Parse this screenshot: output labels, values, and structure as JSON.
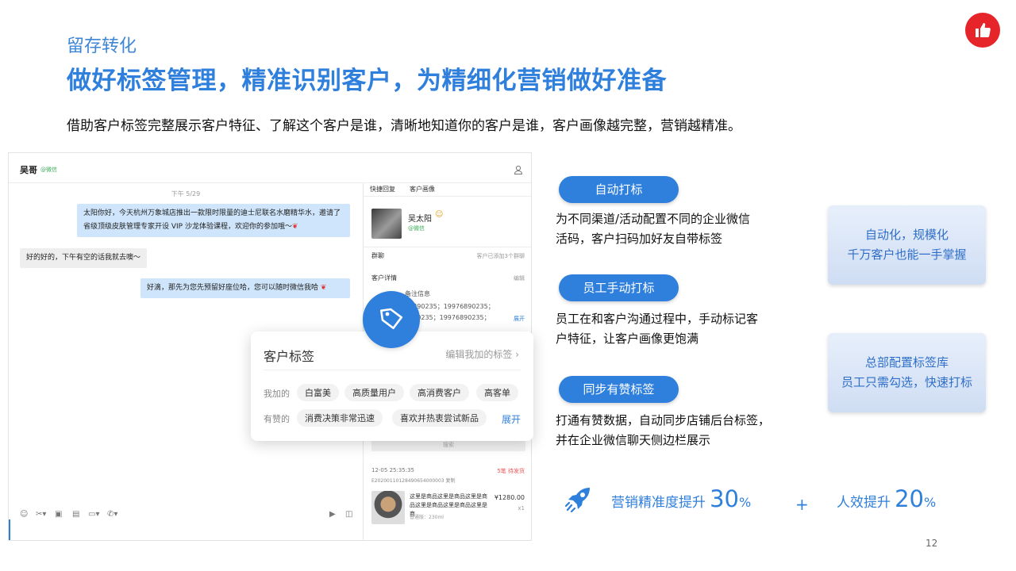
{
  "header": {
    "section": "留存转化",
    "title": "做好标签管理，精准识别客户，为精细化营销做好准备",
    "subtitle": "借助客户标签完整展示客户特征、了解这个客户是谁，清晰地知道你的客户是谁，客户画像越完整，营销越精准。"
  },
  "chat": {
    "contact_name": "吴哥",
    "contact_source": "@微信",
    "time": "下午 5/29",
    "messages": [
      {
        "dir": "out",
        "text": "太阳你好，今天杭州万象城店推出一款限时限量的迪士尼联名水磨精华水，邀请了省级顶级皮肤管理专家开设 VIP 沙龙体验课程，欢迎你的参加哦～"
      },
      {
        "dir": "in",
        "text": "好的好的，下午有空的话我就去噢～"
      },
      {
        "dir": "out",
        "text": "好滴，那先为您先预留好座位哈，您可以随时微信我哈"
      }
    ],
    "panel": {
      "tabs": [
        "快捷回复",
        "客户画像"
      ],
      "profile_name": "吴太阳",
      "profile_source": "@微信",
      "group_label": "群聊",
      "group_value": "客户已添加3个群聊",
      "detail_label": "客户详情",
      "detail_action": "编辑",
      "remark_label": "备注信息",
      "remark_lines": [
        "76890235；19976890235；",
        "6890235；19976890235；"
      ],
      "remark_expand": "展开",
      "search_placeholder": "搜索",
      "order_time": "12-05 25:35:35",
      "order_status": "5笔  待发货",
      "order_id": "E20200110128490654000003  复制",
      "product_name": "这里是商品这里是商品这里是商品这里是商品这里是商品这里是商",
      "product_price": "¥1280.00",
      "product_qty": "x1",
      "product_spec": "普通版：230ml"
    }
  },
  "tag_card": {
    "title": "客户标签",
    "edit": "编辑我加的标签",
    "mine_label": "我加的",
    "mine_tags": [
      "白富美",
      "高质量用户",
      "高消费客户",
      "高客单"
    ],
    "youzan_label": "有赞的",
    "youzan_tags": [
      "消费决策非常迅速",
      "喜欢并热衷尝试新品"
    ],
    "expand": "展开"
  },
  "features": [
    {
      "pill": "自动打标",
      "lines": [
        "为不同渠道/活动配置不同的企业微信",
        "活码，客户扫码加好友自带标签"
      ]
    },
    {
      "pill": "员工手动打标",
      "lines": [
        "员工在和客户沟通过程中，手动标记客",
        "户特征，让客户画像更饱满"
      ]
    },
    {
      "pill": "同步有赞标签",
      "lines": [
        "打通有赞数据，自动同步店铺后台标签，",
        "并在企业微信聊天侧边栏展示"
      ]
    }
  ],
  "summaries": [
    {
      "lines": [
        "自动化，规模化",
        "千万客户也能一手掌握"
      ]
    },
    {
      "lines": [
        "总部配置标签库",
        "员工只需勾选，快速打标"
      ]
    }
  ],
  "stats": {
    "s1_label": "营销精准度提升",
    "s1_value": "30",
    "s1_unit": "%",
    "plus": "+",
    "s2_label": "人效提升",
    "s2_value": "20",
    "s2_unit": "%"
  },
  "page_number": "12",
  "colors": {
    "accent": "#2f7fdc",
    "logo": "#e5252a",
    "bubble_out": "#cfe5fb"
  }
}
